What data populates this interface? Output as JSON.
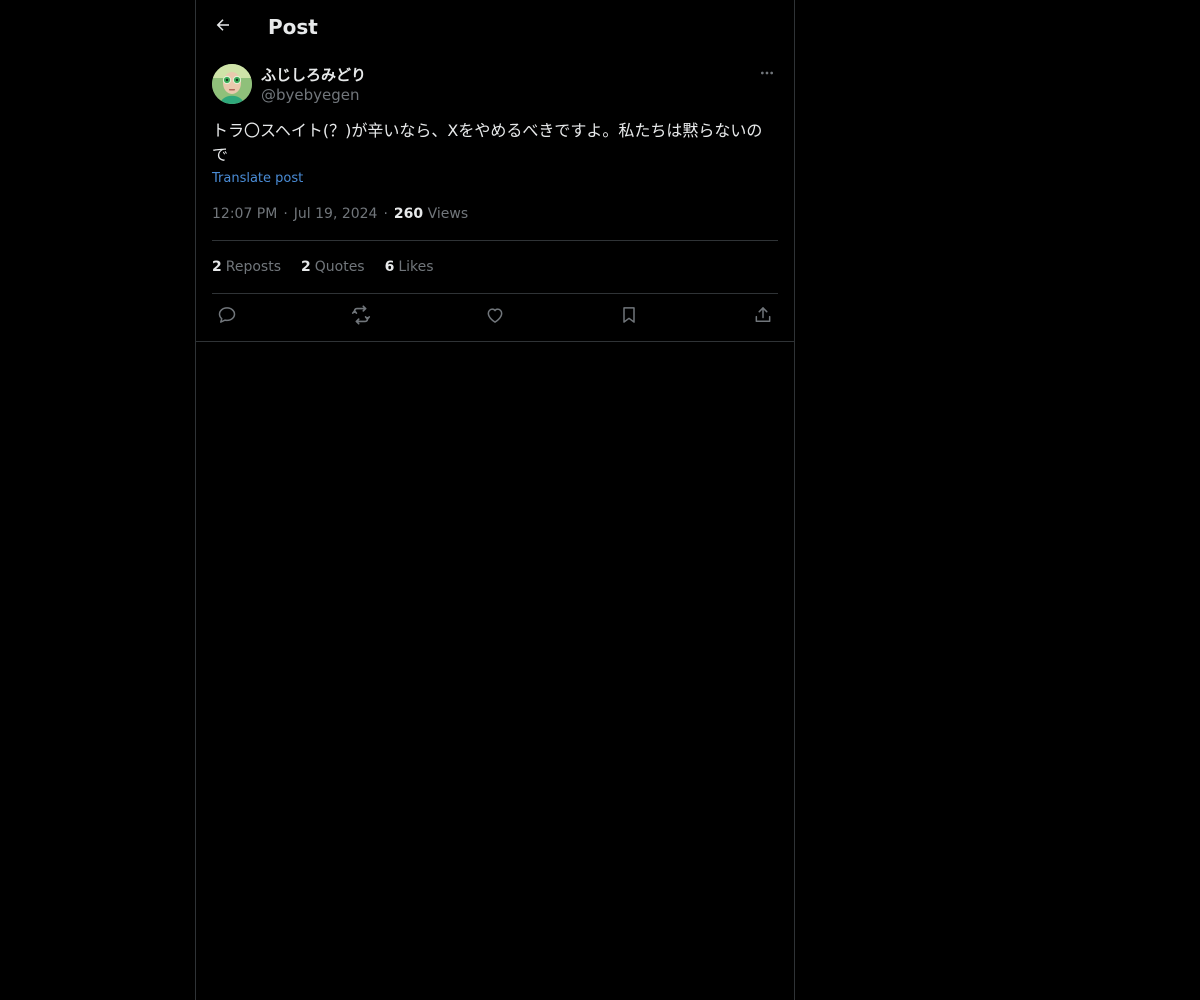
{
  "header": {
    "title": "Post",
    "back_icon": "arrow-left-icon"
  },
  "post": {
    "author": {
      "display_name": "ふじしろみどり",
      "handle": "@byebyegen",
      "avatar_icon": "user-avatar"
    },
    "more_icon": "ellipsis-icon",
    "text": "トラ〇スヘイト(？)が辛いなら、Xをやめるべきですよ。私たちは黙らないので",
    "translate_label": "Translate post",
    "time": "12:07 PM",
    "date": "Jul 19, 2024",
    "separator": "·",
    "views_count": "260",
    "views_label": "Views"
  },
  "stats": {
    "reposts_count": "2",
    "reposts_label": "Reposts",
    "quotes_count": "2",
    "quotes_label": "Quotes",
    "likes_count": "6",
    "likes_label": "Likes"
  },
  "actions": {
    "reply_icon": "reply-icon",
    "repost_icon": "repost-icon",
    "like_icon": "heart-icon",
    "bookmark_icon": "bookmark-icon",
    "share_icon": "share-icon"
  },
  "colors": {
    "background": "#000000",
    "border": "#2f3336",
    "primary_text": "#e7e9ea",
    "secondary_text": "#71767b",
    "link": "#4a8cd6"
  }
}
